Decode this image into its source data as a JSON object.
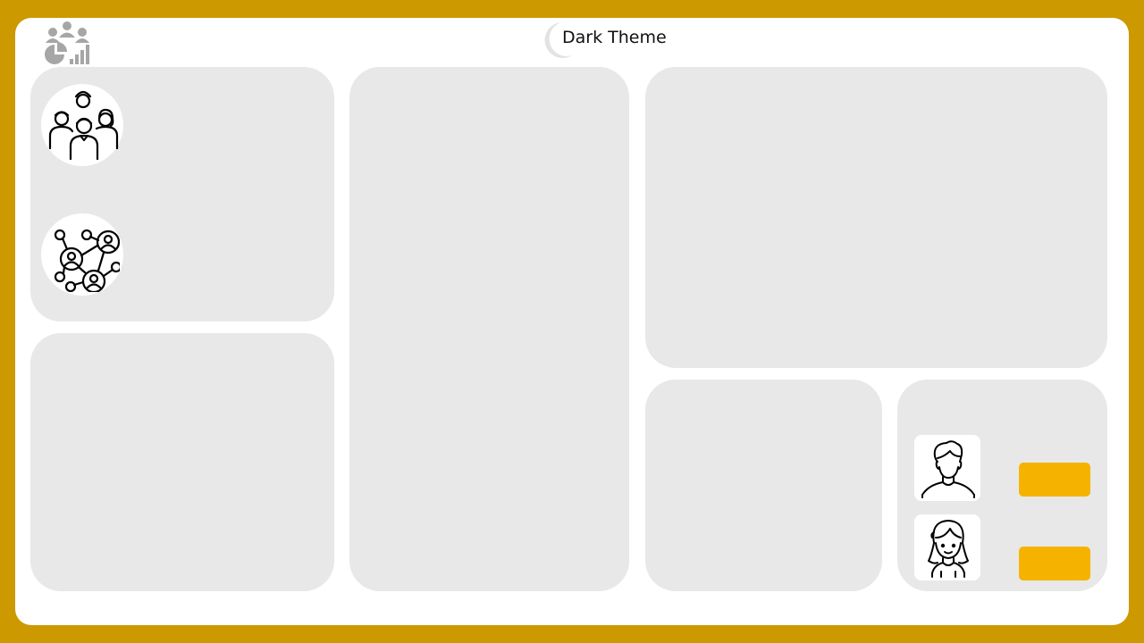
{
  "header": {
    "theme_toggle_label": "Dark Theme",
    "logo_icon": "team-analytics-icon",
    "theme_icon": "moon-icon"
  },
  "panels": {
    "top_left": {
      "icons": [
        "group-people-icon",
        "people-network-icon"
      ]
    },
    "bottom_right": {
      "avatars": [
        "male-avatar-icon",
        "female-avatar-icon"
      ]
    }
  },
  "colors": {
    "outer_border": "#CC9900",
    "canvas": "#FFFFFF",
    "card": "#E8E8E8",
    "accent_button": "#F5B300",
    "icon_gray": "#A6A6A6"
  }
}
